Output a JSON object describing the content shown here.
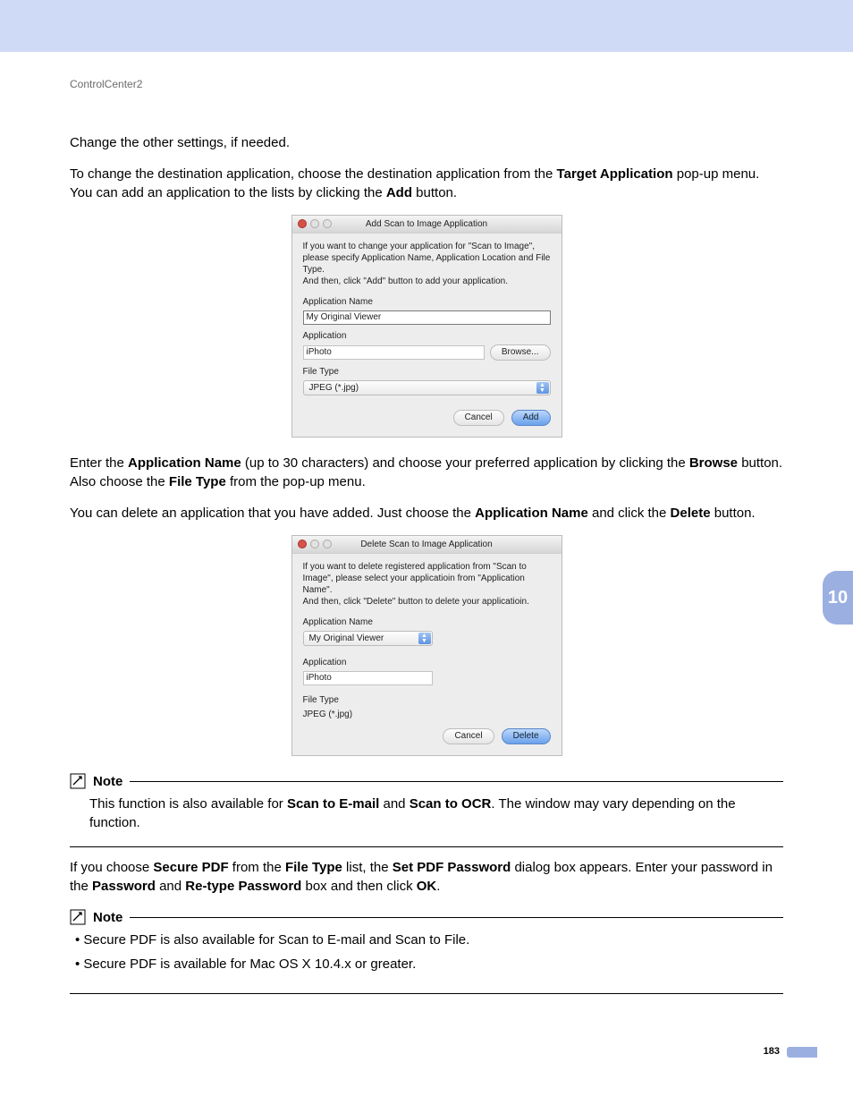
{
  "header": {
    "crumb": "ControlCenter2"
  },
  "chapter_tab": "10",
  "page_number": "183",
  "para1": "Change the other settings, if needed.",
  "para2_a": "To change the destination application, choose the destination application from the ",
  "para2_b": "Target Application",
  "para2_c": " pop-up menu. You can add an application to the lists by clicking the ",
  "para2_d": "Add",
  "para2_e": " button.",
  "add_dialog": {
    "title": "Add Scan to Image Application",
    "desc": "If you want to change your application for \"Scan to Image\", please specify Application Name, Application Location and File Type.\nAnd then, click \"Add\" button to add your application.",
    "app_name_label": "Application Name",
    "app_name_value": "My Original Viewer",
    "app_label": "Application",
    "app_value": "iPhoto",
    "browse_btn": "Browse...",
    "file_type_label": "File Type",
    "file_type_value": "JPEG (*.jpg)",
    "cancel": "Cancel",
    "add": "Add"
  },
  "para3_a": "Enter the ",
  "para3_b": "Application Name",
  "para3_c": " (up to 30 characters) and choose your preferred application by clicking the ",
  "para3_d": "Browse",
  "para3_e": " button. Also choose the ",
  "para3_f": "File Type",
  "para3_g": " from the pop-up menu.",
  "para4_a": "You can delete an application that you have added. Just choose the ",
  "para4_b": "Application Name",
  "para4_c": " and click the ",
  "para4_d": "Delete",
  "para4_e": " button.",
  "del_dialog": {
    "title": "Delete Scan to Image Application",
    "desc": "If you want to delete registered application from \"Scan to Image\", please select your applicatioin from \"Application Name\".\nAnd then, click \"Delete\" button to delete your applicatioin.",
    "app_name_label": "Application Name",
    "app_name_value": "My Original Viewer",
    "app_label": "Application",
    "app_value": "iPhoto",
    "file_type_label": "File Type",
    "file_type_value": "JPEG (*.jpg)",
    "cancel": "Cancel",
    "delete": "Delete"
  },
  "note_label": "Note",
  "note1_a": "This function is also available for ",
  "note1_b": "Scan to E-mail",
  "note1_c": " and ",
  "note1_d": "Scan to OCR",
  "note1_e": ". The window may vary depending on the function.",
  "para5_a": "If you choose ",
  "para5_b": "Secure PDF",
  "para5_c": " from the ",
  "para5_d": "File Type",
  "para5_e": " list, the ",
  "para5_f": "Set PDF Password",
  "para5_g": " dialog box appears. Enter your password in the ",
  "para5_h": "Password",
  "para5_i": " and ",
  "para5_j": "Re-type Password",
  "para5_k": " box and then click ",
  "para5_l": "OK",
  "para5_m": ".",
  "note2_items": [
    "Secure PDF is also available for Scan to E-mail and Scan to File.",
    "Secure PDF is available for Mac OS X 10.4.x or greater."
  ]
}
